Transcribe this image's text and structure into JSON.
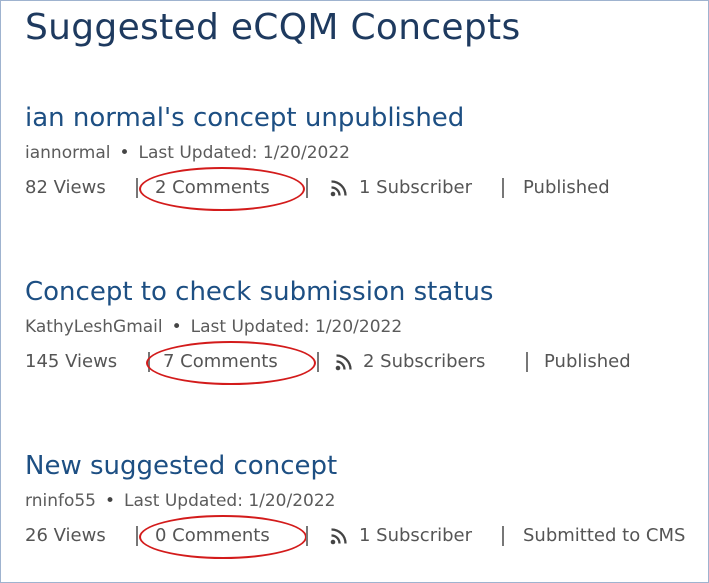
{
  "page": {
    "title": "Suggested eCQM Concepts"
  },
  "concepts": [
    {
      "title": "ian normal's concept unpublished",
      "author": "iannormal",
      "updated": "Last Updated: 1/20/2022",
      "views": "82 Views",
      "comments": "2 Comments",
      "subscribers": "1 Subscriber",
      "status": "Published"
    },
    {
      "title": "Concept to check submission status",
      "author": "KathyLeshGmail",
      "updated": "Last Updated: 1/20/2022",
      "views": "145 Views",
      "comments": "7 Comments",
      "subscribers": "2 Subscribers",
      "status": "Published"
    },
    {
      "title": "New suggested concept",
      "author": "rninfo55",
      "updated": "Last Updated: 1/20/2022",
      "views": "26 Views",
      "comments": "0 Comments",
      "subscribers": "1 Subscriber",
      "status": "Submitted to CMS"
    }
  ],
  "icons": {
    "subscriber": "rss-feed-icon"
  },
  "colors": {
    "title": "#1e3a5f",
    "link": "#1d4f83",
    "annotation": "#d31b1b"
  }
}
